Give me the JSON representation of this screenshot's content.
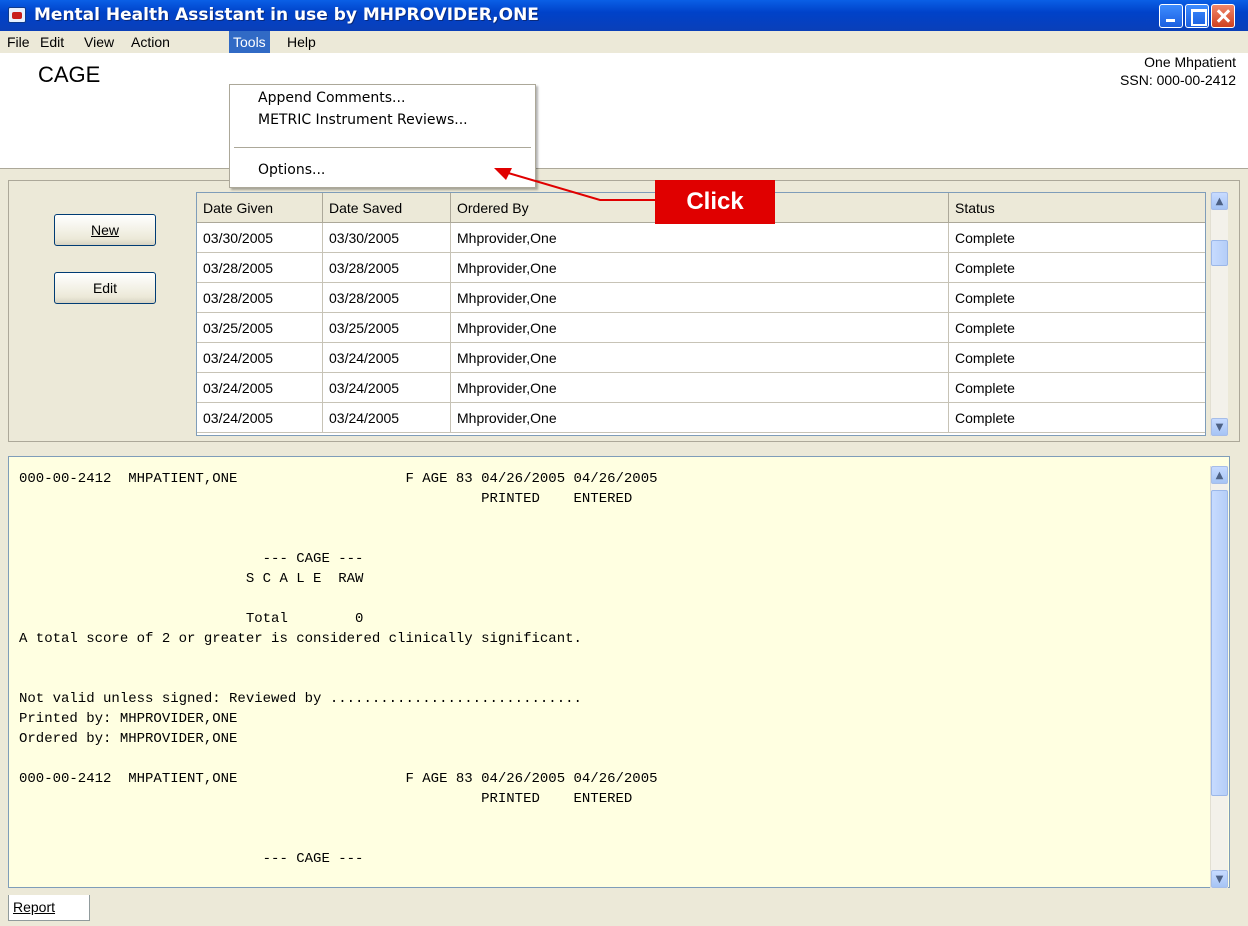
{
  "window": {
    "title": "Mental Health Assistant in use by MHPROVIDER,ONE"
  },
  "menubar": {
    "file": "File",
    "edit": "Edit",
    "view": "View",
    "action": "Action",
    "tools": "Tools",
    "help": "Help"
  },
  "tools_menu": {
    "append": "Append Comments...",
    "metric": "METRIC Instrument Reviews...",
    "options": "Options..."
  },
  "header": {
    "form_title": "CAGE",
    "patient_name": "One Mhpatient",
    "patient_ssn": "SSN: 000-00-2412"
  },
  "buttons": {
    "new": "New",
    "edit": "Edit"
  },
  "grid": {
    "columns": [
      "Date Given",
      "Date Saved",
      "Ordered By",
      "Status"
    ],
    "rows": [
      [
        "03/30/2005",
        "03/30/2005",
        "Mhprovider,One",
        "Complete"
      ],
      [
        "03/28/2005",
        "03/28/2005",
        "Mhprovider,One",
        "Complete"
      ],
      [
        "03/28/2005",
        "03/28/2005",
        "Mhprovider,One",
        "Complete"
      ],
      [
        "03/25/2005",
        "03/25/2005",
        "Mhprovider,One",
        "Complete"
      ],
      [
        "03/24/2005",
        "03/24/2005",
        "Mhprovider,One",
        "Complete"
      ],
      [
        "03/24/2005",
        "03/24/2005",
        "Mhprovider,One",
        "Complete"
      ],
      [
        "03/24/2005",
        "03/24/2005",
        "Mhprovider,One",
        "Complete"
      ]
    ]
  },
  "report": {
    "text": "000-00-2412  MHPATIENT,ONE                    F AGE 83 04/26/2005 04/26/2005\n                                                       PRINTED    ENTERED\n\n\n                             --- CAGE ---\n                           S C A L E  RAW\n\n                           Total        0\nA total score of 2 or greater is considered clinically significant.\n\n\nNot valid unless signed: Reviewed by ..............................\nPrinted by: MHPROVIDER,ONE\nOrdered by: MHPROVIDER,ONE\n\n000-00-2412  MHPATIENT,ONE                    F AGE 83 04/26/2005 04/26/2005\n                                                       PRINTED    ENTERED\n\n\n                             --- CAGE ---"
  },
  "tabs": {
    "report": "Report"
  },
  "annotation": {
    "click": "Click",
    "color": "#e00000"
  }
}
